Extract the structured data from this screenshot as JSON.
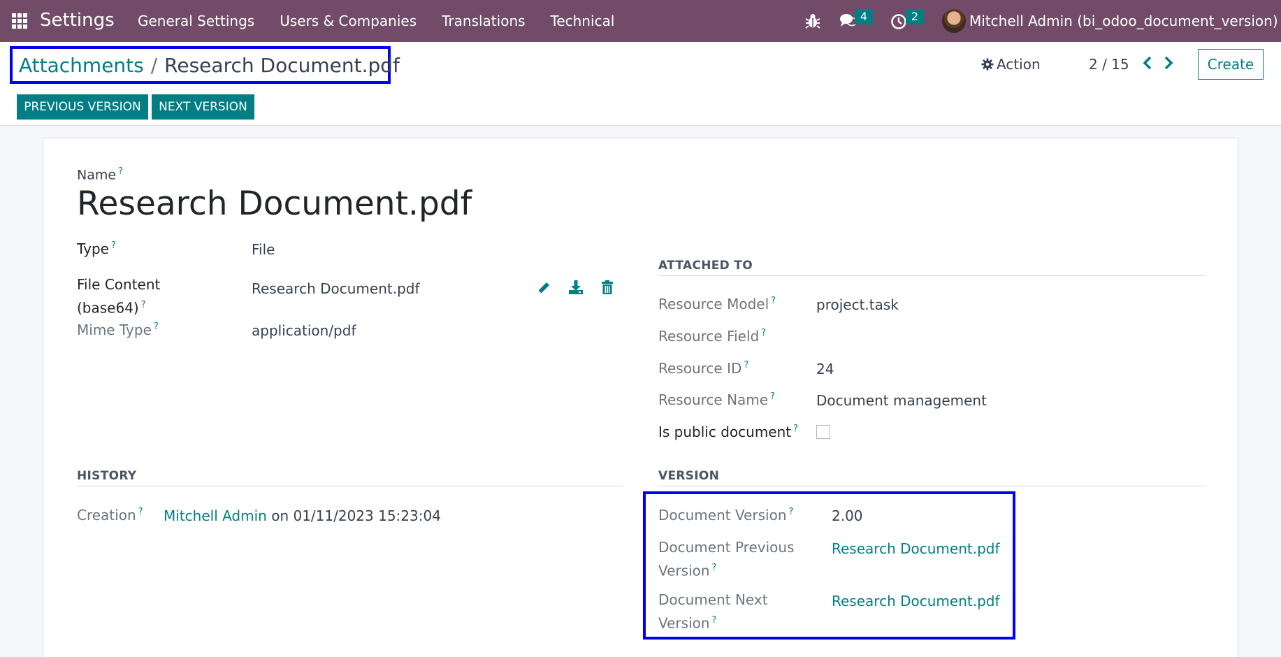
{
  "navbar": {
    "app_name": "Settings",
    "menu": [
      "General Settings",
      "Users & Companies",
      "Translations",
      "Technical"
    ],
    "messages_count": "4",
    "activities_count": "2",
    "user_name": "Mitchell Admin (bi_odoo_document_version)"
  },
  "control": {
    "breadcrumb_parent": "Attachments",
    "breadcrumb_sep": "/",
    "breadcrumb_current": "Research Document.pdf",
    "action_label": "Action",
    "pager": "2 / 15",
    "create_label": "Create",
    "prev_version_label": "PREVIOUS VERSION",
    "next_version_label": "NEXT VERSION"
  },
  "form": {
    "name_label": "Name",
    "name_value": "Research Document.pdf",
    "type_label": "Type",
    "type_value": "File",
    "file_content_label_1": "File Content",
    "file_content_label_2": "(base64)",
    "file_content_value": "Research Document.pdf",
    "mime_label": "Mime Type",
    "mime_value": "application/pdf",
    "help_mark": "?"
  },
  "attached_to": {
    "title": "ATTACHED TO",
    "resource_model_label": "Resource Model",
    "resource_model_value": "project.task",
    "resource_field_label": "Resource Field",
    "resource_id_label": "Resource ID",
    "resource_id_value": "24",
    "resource_name_label": "Resource Name",
    "resource_name_value": "Document management",
    "is_public_label": "Is public document",
    "is_public_checked": false
  },
  "history": {
    "title": "HISTORY",
    "creation_label": "Creation",
    "creation_user": "Mitchell Admin",
    "creation_on": "on 01/11/2023 15:23:04"
  },
  "version": {
    "title": "VERSION",
    "doc_version_label": "Document Version",
    "doc_version_value": "2.00",
    "prev_label_1": "Document Previous",
    "prev_label_2": "Version",
    "prev_value": "Research Document.pdf",
    "next_label_1": "Document Next",
    "next_label_2": "Version",
    "next_value": "Research Document.pdf"
  },
  "colors": {
    "navbar": "#714b67",
    "accent": "#017e84",
    "highlight": "#0000ee"
  },
  "icons": [
    "apps-icon",
    "bug-icon",
    "chat-icon",
    "clock-icon",
    "gear-icon",
    "chevron-left-icon",
    "chevron-right-icon",
    "pencil-icon",
    "download-icon",
    "trash-icon"
  ]
}
